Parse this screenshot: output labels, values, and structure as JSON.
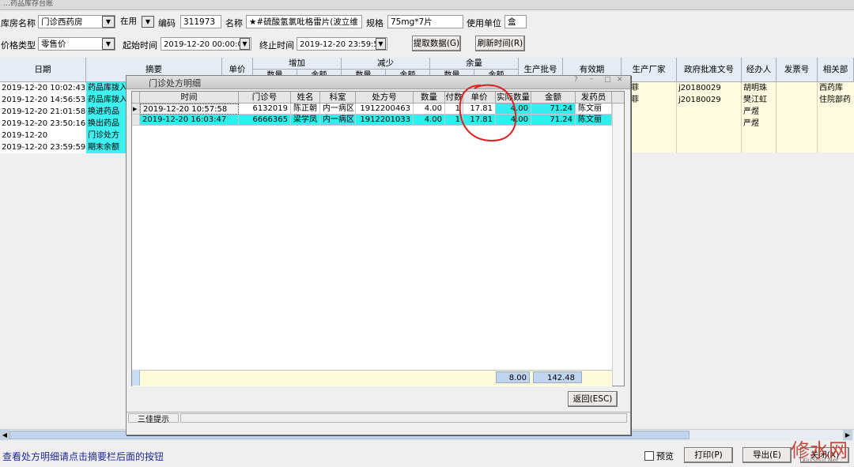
{
  "window_title": "…药品库存台账",
  "filters": {
    "warehouse_label": "库房名称",
    "warehouse_value": "门诊西药房",
    "status_value": "在用",
    "code_label": "编码",
    "code_value": "311973",
    "name_label": "名称",
    "name_value": "★#硫酸氢氯吡格雷片(波立维",
    "spec_label": "规格",
    "spec_value": "75mg*7片",
    "unit_label": "使用单位",
    "unit_value": "盒",
    "price_type_label": "价格类型",
    "price_type_value": "零售价",
    "start_label": "起始时间",
    "start_value": "2019-12-20 00:00:00",
    "end_label": "终止时间",
    "end_value": "2019-12-20 23:59:59",
    "fetch_button": "提取数据(G)",
    "refresh_button": "刷新时间(R)"
  },
  "main_table": {
    "headers": {
      "date": "日期",
      "summary": "摘要",
      "unit_price": "单价",
      "increase": "增加",
      "decrease": "减少",
      "balance": "余量",
      "qty": "数量",
      "amount": "金额",
      "batch": "生产批号",
      "expiry": "有效期",
      "manufacturer": "生产厂家",
      "approval": "政府批准文号",
      "handler": "经办人",
      "invoice": "发票号",
      "related": "相关部"
    },
    "rows": [
      {
        "date": "2019-12-20 10:02:43",
        "summary": "药品库拨入",
        "manufacturer": "诺菲",
        "approval": "j20180029",
        "handler": "胡明珠",
        "related": "西药库"
      },
      {
        "date": "2019-12-20 14:56:53",
        "summary": "药品库拨入",
        "manufacturer": "诺菲",
        "approval": "j20180029",
        "handler": "樊江虹",
        "related": "住院部药"
      },
      {
        "date": "2019-12-20 21:01:58",
        "summary": "换进药品",
        "manufacturer": "",
        "approval": "",
        "handler": "严煜",
        "related": ""
      },
      {
        "date": "2019-12-20 23:50:16",
        "summary": "换出药品",
        "manufacturer": "",
        "approval": "",
        "handler": "严煜",
        "related": ""
      },
      {
        "date": "2019-12-20",
        "summary": "门诊处方",
        "manufacturer": "",
        "approval": "",
        "handler": "",
        "related": ""
      },
      {
        "date": "2019-12-20 23:59:59",
        "summary": "期末余额",
        "manufacturer": "",
        "approval": "",
        "handler": "",
        "related": ""
      }
    ]
  },
  "modal": {
    "title": "门诊处方明细",
    "headers": {
      "time": "时间",
      "visit_no": "门诊号",
      "patient": "姓名",
      "dept": "科室",
      "rx_no": "处方号",
      "qty": "数量",
      "doses": "付数",
      "unit_price": "单价",
      "actual_qty": "实际数量",
      "amount": "金额",
      "dispenser": "发药员"
    },
    "rows": [
      {
        "time": "2019-12-20 10:57:58",
        "visit_no": "6132019",
        "patient": "陈正朝",
        "dept": "内一病区",
        "rx_no": "1912200463",
        "qty": "4.00",
        "doses": "1",
        "unit_price": "17.81",
        "actual_qty": "4.00",
        "amount": "71.24",
        "dispenser": "陈文丽"
      },
      {
        "time": "2019-12-20 16:03:47",
        "visit_no": "6666365",
        "patient": "梁学凤",
        "dept": "内一病区",
        "rx_no": "1912201033",
        "qty": "4.00",
        "doses": "1",
        "unit_price": "17.81",
        "actual_qty": "4.00",
        "amount": "71.24",
        "dispenser": "陈文丽"
      }
    ],
    "total_qty": "8.00",
    "total_amount": "142.48",
    "back_button": "返回(ESC)",
    "status_text": "三佳提示"
  },
  "status_hint": "查看处方明细请点击摘要栏后面的按钮",
  "bottom": {
    "preview_label": "预览",
    "print_button": "打印(P)",
    "export_button": "导出(E)",
    "close_button": "关闭(X)"
  },
  "watermark": {
    "brand": "修水网",
    "url": "XiuShui.Net"
  },
  "colors": {
    "selection_cyan": "#33ecec",
    "summary_cyan": "#3ff0f0",
    "row_yellow": "#fffbd8",
    "annotation_red": "#e02020",
    "hint_blue": "#1a2a9a"
  }
}
